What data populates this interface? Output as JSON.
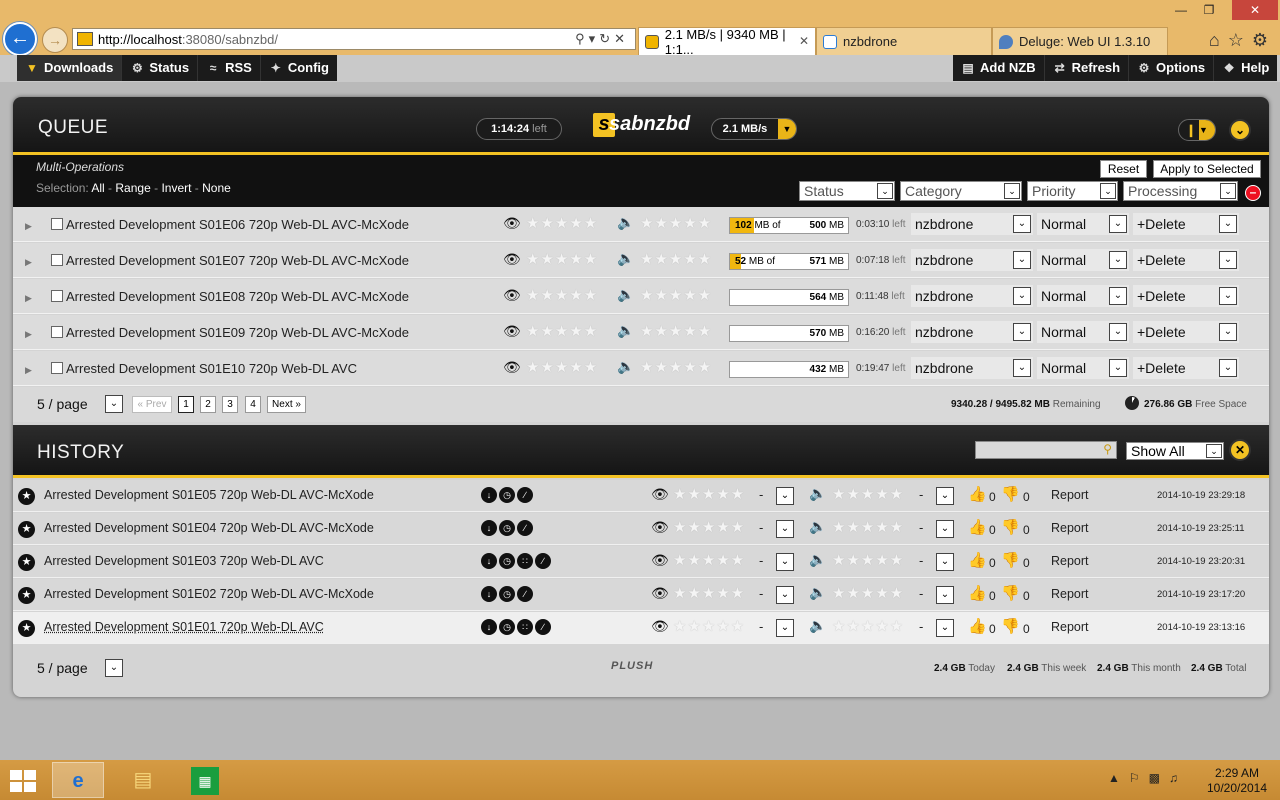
{
  "browser": {
    "address_host": "http://localhost",
    "address_rest": ":38080/sabnzbd/",
    "tabs": [
      {
        "label": "2.1 MB/s | 9340 MB | 1:1...",
        "active": true
      },
      {
        "label": "nzbdrone",
        "active": false
      },
      {
        "label": "Deluge: Web UI 1.3.10",
        "active": false
      }
    ]
  },
  "nav": {
    "left": [
      {
        "label": "Downloads",
        "icon": "downloads-icon"
      },
      {
        "label": "Status",
        "icon": "gear-icon"
      },
      {
        "label": "RSS",
        "icon": "rss-icon"
      },
      {
        "label": "Config",
        "icon": "wrench-icon"
      }
    ],
    "right": [
      {
        "label": "Add NZB",
        "icon": "add-nzb-icon"
      },
      {
        "label": "Refresh",
        "icon": "refresh-icon"
      },
      {
        "label": "Options",
        "icon": "options-icon"
      },
      {
        "label": "Help",
        "icon": "help-icon"
      }
    ]
  },
  "queue": {
    "title": "QUEUE",
    "time_left": "1:14:24",
    "time_left_suffix": "left",
    "logo": "sabnzbd",
    "speed": "2.1 MB/s",
    "multi_ops": {
      "title": "Multi-Operations",
      "selection_label": "Selection:",
      "all": "All",
      "range": "Range",
      "invert": "Invert",
      "none": "None",
      "reset": "Reset",
      "apply": "Apply to Selected",
      "filters": [
        "Status",
        "Category",
        "Priority",
        "Processing"
      ]
    },
    "rows": [
      {
        "name": "Arrested Development S01E06 720p Web-DL AVC-McXode",
        "done": "102",
        "total": "500",
        "progress": 0.204,
        "eta": "0:03:10",
        "category": "nzbdrone",
        "priority": "Normal",
        "processing": "+Delete"
      },
      {
        "name": "Arrested Development S01E07 720p Web-DL AVC-McXode",
        "done": "52",
        "total": "571",
        "progress": 0.091,
        "eta": "0:07:18",
        "category": "nzbdrone",
        "priority": "Normal",
        "processing": "+Delete"
      },
      {
        "name": "Arrested Development S01E08 720p Web-DL AVC-McXode",
        "done": "",
        "total": "564",
        "progress": 0,
        "eta": "0:11:48",
        "category": "nzbdrone",
        "priority": "Normal",
        "processing": "+Delete"
      },
      {
        "name": "Arrested Development S01E09 720p Web-DL AVC-McXode",
        "done": "",
        "total": "570",
        "progress": 0,
        "eta": "0:16:20",
        "category": "nzbdrone",
        "priority": "Normal",
        "processing": "+Delete"
      },
      {
        "name": "Arrested Development S01E10 720p Web-DL AVC",
        "done": "",
        "total": "432",
        "progress": 0,
        "eta": "0:19:47",
        "category": "nzbdrone",
        "priority": "Normal",
        "processing": "+Delete"
      }
    ],
    "mb_unit": "MB",
    "mb_of": "MB of",
    "eta_suffix": "left",
    "per_page": "5 / page",
    "pages": [
      "1",
      "2",
      "3",
      "4"
    ],
    "prev": "« Prev",
    "next": "Next »",
    "remaining_values": "9340.28 / 9495.82 MB",
    "remaining_label": "Remaining",
    "free_space": "276.86 GB",
    "free_space_label": "Free Space"
  },
  "history": {
    "title": "HISTORY",
    "filter": "Show All",
    "rows": [
      {
        "name": "Arrested Development S01E05 720p Web-DL AVC-McXode",
        "time": "2014-10-19 23:29:18",
        "extra_icon": false
      },
      {
        "name": "Arrested Development S01E04 720p Web-DL AVC-McXode",
        "time": "2014-10-19 23:25:11",
        "extra_icon": false
      },
      {
        "name": "Arrested Development S01E03 720p Web-DL AVC",
        "time": "2014-10-19 23:20:31",
        "extra_icon": true
      },
      {
        "name": "Arrested Development S01E02 720p Web-DL AVC-McXode",
        "time": "2014-10-19 23:17:20",
        "extra_icon": false
      },
      {
        "name": "Arrested Development S01E01 720p Web-DL AVC",
        "time": "2014-10-19 23:13:16",
        "extra_icon": true
      }
    ],
    "dash": "-",
    "votes_up": "0",
    "votes_down": "0",
    "report": "Report",
    "per_page": "5 / page",
    "brand": "PLUSH",
    "stats": [
      {
        "value": "2.4 GB",
        "label": "Today"
      },
      {
        "value": "2.4 GB",
        "label": "This week"
      },
      {
        "value": "2.4 GB",
        "label": "This month"
      },
      {
        "value": "2.4 GB",
        "label": "Total"
      }
    ]
  },
  "taskbar": {
    "time": "2:29 AM",
    "date": "10/20/2014"
  },
  "colors": {
    "accent": "#f3c223",
    "header_dark": "#1b1b1b",
    "panel": "#d4d4d4"
  }
}
